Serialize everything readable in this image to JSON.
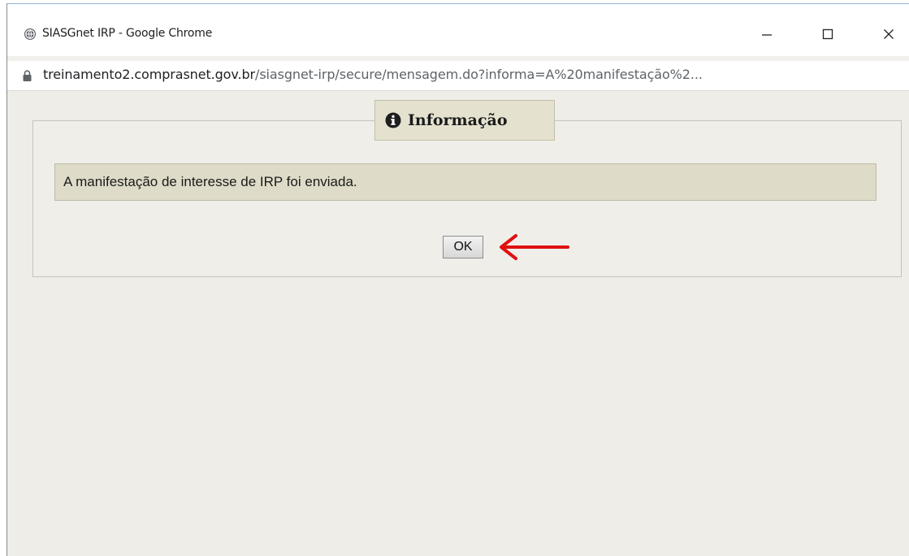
{
  "window": {
    "title": "SIASGnet IRP - Google Chrome",
    "controls": {
      "minimize": "minimize-icon",
      "maximize": "maximize-icon",
      "close": "close-icon"
    }
  },
  "address_bar": {
    "domain": "treinamento2.comprasnet.gov.br",
    "path": "/siasgnet-irp/secure/mensagem.do?informa=A%20manifestação%2..."
  },
  "dialog": {
    "legend": "Informação",
    "legend_icon": "info-icon",
    "message": "A manifestação de interesse de IRP foi enviada.",
    "ok_label": "OK"
  },
  "annotation": {
    "arrow_color": "#e01010",
    "arrow_icon": "arrow-left-icon"
  }
}
